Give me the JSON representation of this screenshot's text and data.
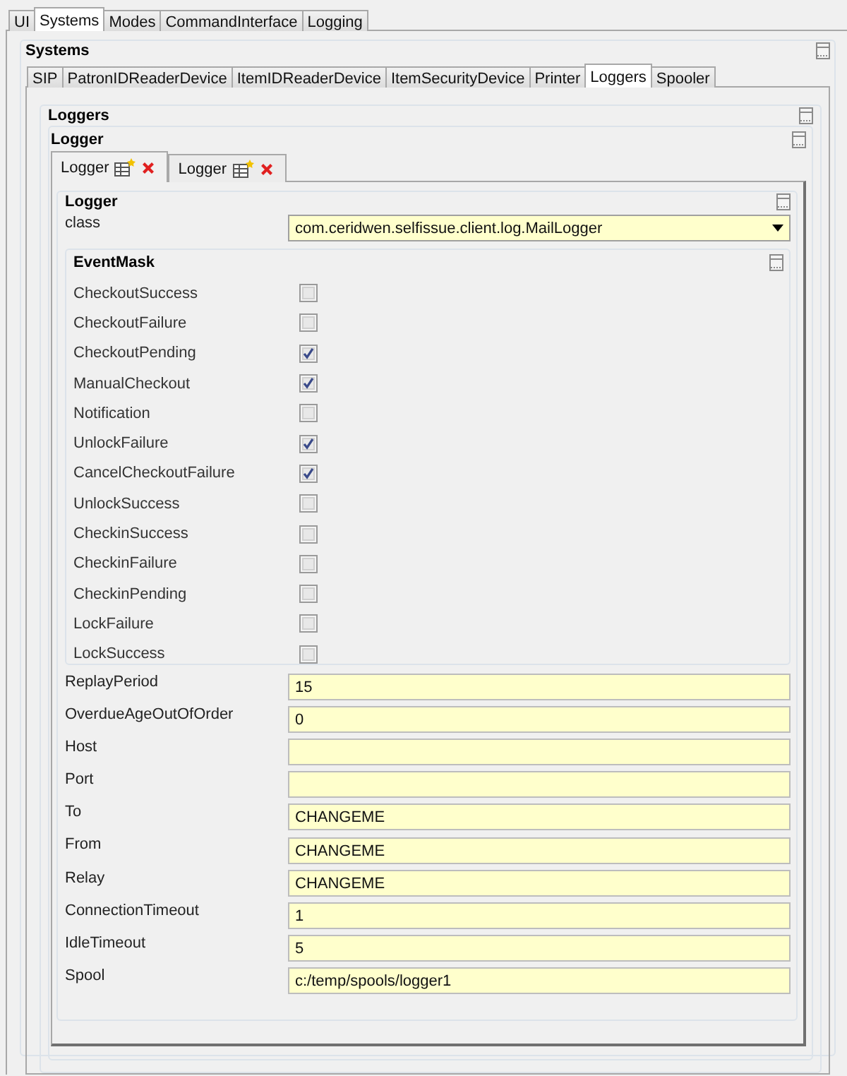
{
  "top_tabs": [
    {
      "label": "UI",
      "selected": false
    },
    {
      "label": "Systems",
      "selected": true
    },
    {
      "label": "Modes",
      "selected": false
    },
    {
      "label": "CommandInterface",
      "selected": false
    },
    {
      "label": "Logging",
      "selected": false
    }
  ],
  "systems_title": "Systems",
  "system_tabs": [
    {
      "label": "SIP",
      "selected": false
    },
    {
      "label": "PatronIDReaderDevice",
      "selected": false
    },
    {
      "label": "ItemIDReaderDevice",
      "selected": false
    },
    {
      "label": "ItemSecurityDevice",
      "selected": false
    },
    {
      "label": "Printer",
      "selected": false
    },
    {
      "label": "Loggers",
      "selected": true
    },
    {
      "label": "Spooler",
      "selected": false
    }
  ],
  "loggers_title": "Loggers",
  "logger_title": "Logger",
  "logger_tabs": [
    {
      "label": "Logger",
      "selected": true
    },
    {
      "label": "Logger",
      "selected": false
    }
  ],
  "form_title": "Logger",
  "class_field": {
    "label": "class",
    "value": "com.ceridwen.selfissue.client.log.MailLogger"
  },
  "event_mask_title": "EventMask",
  "event_mask": [
    {
      "label": "CheckoutSuccess",
      "checked": false
    },
    {
      "label": "CheckoutFailure",
      "checked": false
    },
    {
      "label": "CheckoutPending",
      "checked": true
    },
    {
      "label": "ManualCheckout",
      "checked": true
    },
    {
      "label": "Notification",
      "checked": false
    },
    {
      "label": "UnlockFailure",
      "checked": true
    },
    {
      "label": "CancelCheckoutFailure",
      "checked": true
    },
    {
      "label": "UnlockSuccess",
      "checked": false
    },
    {
      "label": "CheckinSuccess",
      "checked": false
    },
    {
      "label": "CheckinFailure",
      "checked": false
    },
    {
      "label": "CheckinPending",
      "checked": false
    },
    {
      "label": "LockFailure",
      "checked": false
    },
    {
      "label": "LockSuccess",
      "checked": false
    }
  ],
  "fields": [
    {
      "label": "ReplayPeriod",
      "value": "15"
    },
    {
      "label": "OverdueAgeOutOfOrder",
      "value": "0"
    },
    {
      "label": "Host"
    },
    {
      "label": "Port"
    },
    {
      "label": "To",
      "value": "CHANGEME"
    },
    {
      "label": "From",
      "value": "CHANGEME"
    },
    {
      "label": "Relay",
      "value": "CHANGEME"
    },
    {
      "label": "ConnectionTimeout",
      "value": "1"
    },
    {
      "label": "IdleTimeout",
      "value": "5"
    },
    {
      "label": "Spool",
      "value": "c:/temp/spools/logger1"
    }
  ]
}
